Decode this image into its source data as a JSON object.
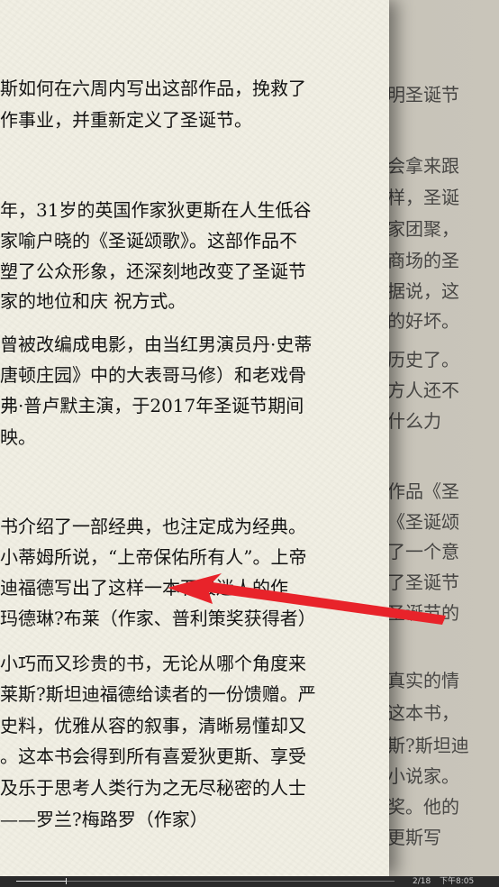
{
  "reader": {
    "left_page_lines": [
      "斯如何在六周内写出这部作品，挽救了",
      "作事业，并重新定义了圣诞节。",
      "年，31岁的英国作家狄更斯在人生低谷",
      "家喻户晓的《圣诞颂歌》。这部作品不",
      "塑了公众形象，还深刻地改变了圣诞节",
      "家的地位和庆 祝方式。",
      "曾被改编成电影，由当红男演员丹·史蒂",
      "唐顿庄园》中的大表哥马修）和老戏骨",
      "弗·普卢默主演，于2017年圣诞节期间",
      "映。",
      "书介绍了一部经典，也注定成为经典。",
      "小蒂姆所说，“上帝保佑所有人”。上帝",
      "迪福德写出了这样一本石般迷人的作",
      "玛德琳?布莱（作家、普利策奖获得者）",
      "小巧而又珍贵的书，无论从哪个角度来",
      "莱斯?斯坦迪福德给读者的一份馈赠。严",
      "史料，优雅从容的叙事，清晰易懂却又",
      "。这本书会得到所有喜爱狄更斯、享受",
      "及乐于思考人类行为之无尽秘密的人士",
      "——罗兰?梅路罗（作家）"
    ],
    "right_page_lines": [
      "明圣诞节",
      "会拿来跟",
      "样，圣诞",
      "家团聚，",
      "商场的圣",
      "据说，这",
      "的好坏。",
      "历史了。",
      "方人还不",
      "什么力",
      "作品《圣",
      "《圣诞颂",
      "了一个意",
      "了圣诞节",
      "圣诞节的",
      "真实的情",
      "这本书，",
      "斯?斯坦迪",
      "小说家。",
      "奖。他的",
      "更斯写"
    ]
  },
  "status": {
    "page_indicator": "2/18",
    "time": "下午8:05",
    "progress_fraction": 0.13
  },
  "colors": {
    "annotation_arrow": "#e8232a",
    "paper": "#f1efe3",
    "status_bar": "#2a2a2a"
  },
  "icons": {
    "annotation": "red-arrow-icon"
  }
}
